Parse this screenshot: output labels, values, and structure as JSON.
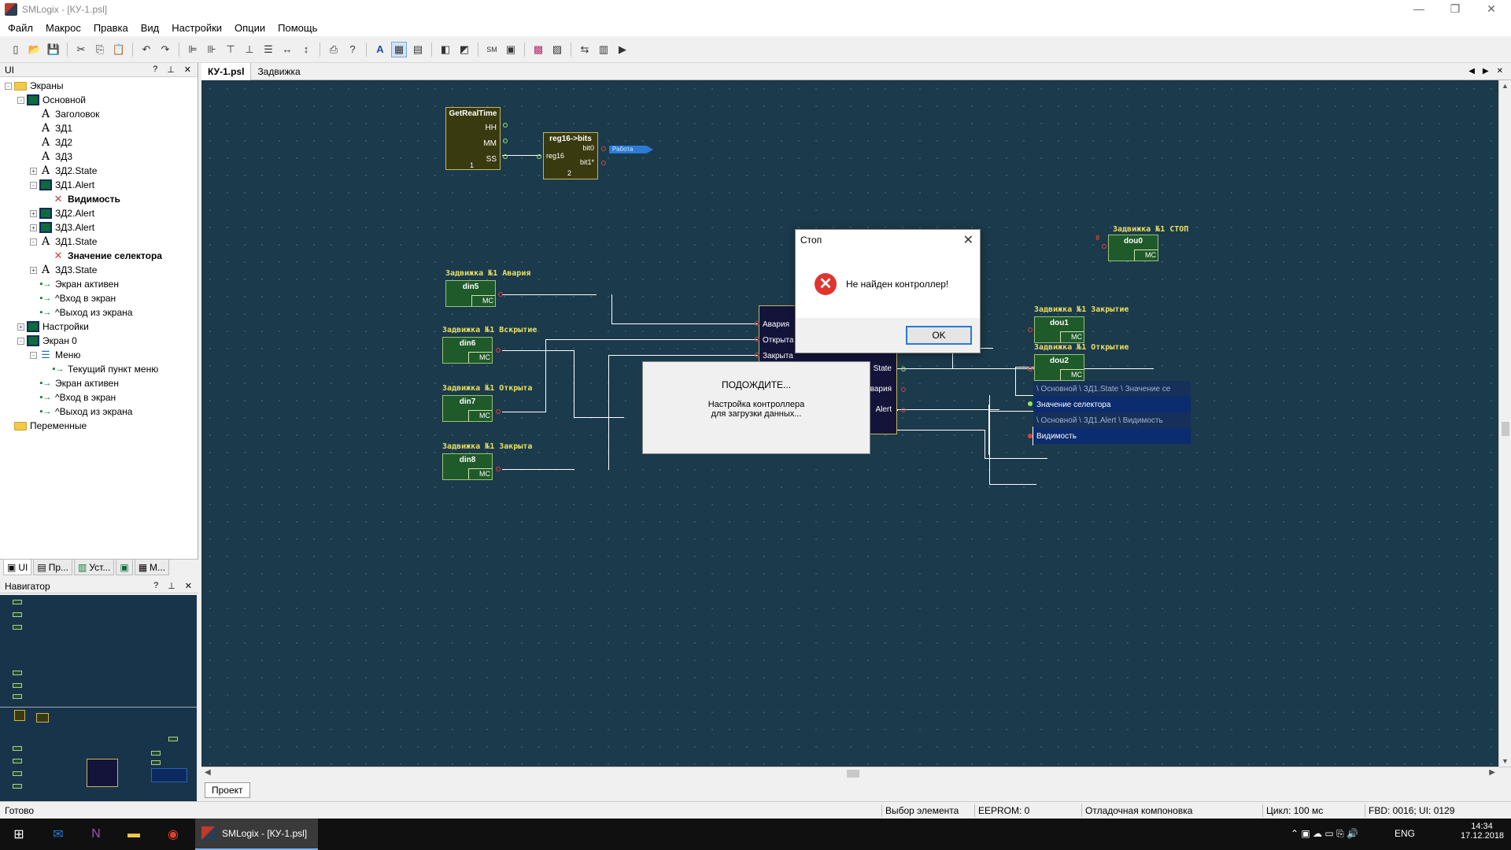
{
  "window": {
    "title": "SMLogix - [КУ-1.psl]"
  },
  "menu": [
    "Файл",
    "Макрос",
    "Правка",
    "Вид",
    "Настройки",
    "Опции",
    "Помощь"
  ],
  "ui_panel": {
    "title": "UI",
    "header_buttons": [
      "?",
      "⊥",
      "✕"
    ],
    "tree": [
      {
        "label": "Экраны",
        "icon": "folder-icon",
        "level": 0,
        "expand": "-"
      },
      {
        "label": "Основной",
        "icon": "screen-icon",
        "level": 1,
        "expand": "-"
      },
      {
        "label": "Заголовок",
        "icon": "text-icon",
        "level": 2
      },
      {
        "label": "ЗД1",
        "icon": "text-icon",
        "level": 2
      },
      {
        "label": "ЗД2",
        "icon": "text-icon",
        "level": 2
      },
      {
        "label": "ЗД3",
        "icon": "text-icon",
        "level": 2
      },
      {
        "label": "ЗД2.State",
        "icon": "text-icon",
        "level": 2,
        "expand": "+"
      },
      {
        "label": "ЗД1.Alert",
        "icon": "screen-icon",
        "level": 2,
        "expand": "-"
      },
      {
        "label": "Видимость",
        "icon": "property-icon",
        "level": 3,
        "bold": true
      },
      {
        "label": "ЗД2.Alert",
        "icon": "screen-icon",
        "level": 2,
        "expand": "+"
      },
      {
        "label": "ЗД3.Alert",
        "icon": "screen-icon",
        "level": 2,
        "expand": "+"
      },
      {
        "label": "ЗД1.State",
        "icon": "text-icon",
        "level": 2,
        "expand": "-"
      },
      {
        "label": "Значение селектора",
        "icon": "property-icon",
        "level": 3,
        "bold": true
      },
      {
        "label": "ЗД3.State",
        "icon": "text-icon",
        "level": 2,
        "expand": "+"
      },
      {
        "label": "Экран активен",
        "icon": "event-icon",
        "level": 2
      },
      {
        "label": "^Вход в экран",
        "icon": "event-icon",
        "level": 2
      },
      {
        "label": "^Выход из экрана",
        "icon": "event-icon",
        "level": 2
      },
      {
        "label": "Настройки",
        "icon": "screen-icon",
        "level": 1,
        "expand": "+"
      },
      {
        "label": "Экран 0",
        "icon": "screen-icon",
        "level": 1,
        "expand": "-"
      },
      {
        "label": "Меню",
        "icon": "menu-icon",
        "level": 2,
        "expand": "-"
      },
      {
        "label": "Текущий пункт меню",
        "icon": "event-icon",
        "level": 3
      },
      {
        "label": "Экран активен",
        "icon": "event-icon",
        "level": 2
      },
      {
        "label": "^Вход в экран",
        "icon": "event-icon",
        "level": 2
      },
      {
        "label": "^Выход из экрана",
        "icon": "event-icon",
        "level": 2
      },
      {
        "label": "Переменные",
        "icon": "folder-icon",
        "level": 0
      }
    ],
    "bottom_tabs": [
      "UI",
      "Пр...",
      "Уст...",
      "",
      "М..."
    ]
  },
  "navigator": {
    "title": "Навигатор"
  },
  "doc_tabs": [
    "КУ-1.psl",
    "Задвижка"
  ],
  "canvas": {
    "getrealtime": {
      "title": "GetRealTime",
      "pins": [
        "HH",
        "MM",
        "SS"
      ],
      "num": "1"
    },
    "reg16": {
      "title": "reg16->bits",
      "in": "reg16",
      "pins": [
        "bit0",
        "bit1*"
      ],
      "num": "2"
    },
    "reg_tag": "Работа",
    "stop_tag": "Задвижка №1 СТОП",
    "stop_const": "0",
    "dou0": "dou0",
    "din_blocks": [
      {
        "tag": "Задвижка №1 Авария",
        "name": "din5"
      },
      {
        "tag": "Задвижка №1 Вскрытие",
        "name": "din6"
      },
      {
        "tag": "Задвижка №1 Открыта",
        "name": "din7"
      },
      {
        "tag": "Задвижка №1 Закрыта",
        "name": "din8"
      }
    ],
    "mc": "MC",
    "main_block_inputs": [
      "Авария",
      "Открыта",
      "Закрыта"
    ],
    "main_block_outputs": [
      "State",
      "Авария",
      "Alert"
    ],
    "dou1": {
      "tag": "Задвижка №1 Закрытие",
      "name": "dou1"
    },
    "dou2": {
      "tag": "Задвижка №1 Открытие",
      "name": "dou2"
    },
    "selector": [
      "\\ Основной \\ ЗД1.State \\ Значение се",
      "Значение селектора",
      "\\ Основной \\ ЗД1.Alert \\  Видимость",
      "Видимость"
    ]
  },
  "wait_dialog": {
    "title": "ПОДОЖДИТЕ...",
    "line1": "Настройка контроллера",
    "line2": "для загрузки данных..."
  },
  "stop_dialog": {
    "title": "Стоп",
    "message": "Не найден контроллер!",
    "ok": "OK"
  },
  "project_tab": "Проект",
  "status": {
    "left": "Готово",
    "mode": "Выбор элемента",
    "eeprom": "EEPROM: 0",
    "build": "Отладочная компоновка",
    "cycle": "Цикл: 100 мс",
    "fbd": "FBD: 0016; UI: 0129"
  },
  "taskbar": {
    "active_app": "SMLogix - [КУ-1.psl]",
    "lang": "ENG",
    "time": "14:34",
    "date": "17.12.2018"
  }
}
